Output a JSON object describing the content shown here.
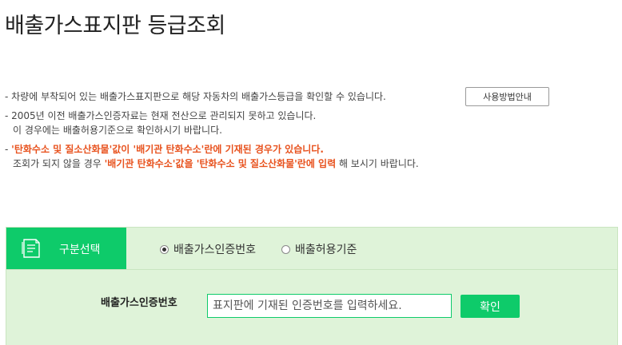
{
  "page": {
    "title": "배출가스표지판 등급조회"
  },
  "notes": {
    "line1": "- 차량에 부착되어 있는 배출가스표지판으로 해당 자동차의 배출가스등급을 확인할 수 있습니다.",
    "help_button": "사용방법안내",
    "line2": "- 2005년 이전 배출가스인증자료는 현재 전산으로 관리되지 못하고 있습니다.",
    "line3": "이 경우에는 배출허용기준으로 확인하시기 바랍니다.",
    "line4_prefix": "- ",
    "line4_highlight": "'탄화수소 및 질소산화물'값이 '배기관 탄화수소'란에 기재된 경우가 있습니다.",
    "line5_text1": "조회가 되지 않을 경우 ",
    "line5_highlight": "'배기관 탄화수소'값을 '탄화수소 및 질소산화물'란에 입력",
    "line5_text2": " 해 보시기 바랍니다."
  },
  "category": {
    "tab_label": "구분선택",
    "tab_icon": "document-icon",
    "options": [
      {
        "label": "배출가스인증번호",
        "selected": true
      },
      {
        "label": "배출허용기준",
        "selected": false
      }
    ]
  },
  "form": {
    "label": "배출가스인증번호",
    "placeholder": "표지판에 기재된 인증번호를 입력하세요.",
    "value": "",
    "confirm_label": "확인"
  },
  "colors": {
    "accent": "#0ecb6a",
    "panel_bg": "#dff3d9",
    "highlight": "#e8521e"
  }
}
